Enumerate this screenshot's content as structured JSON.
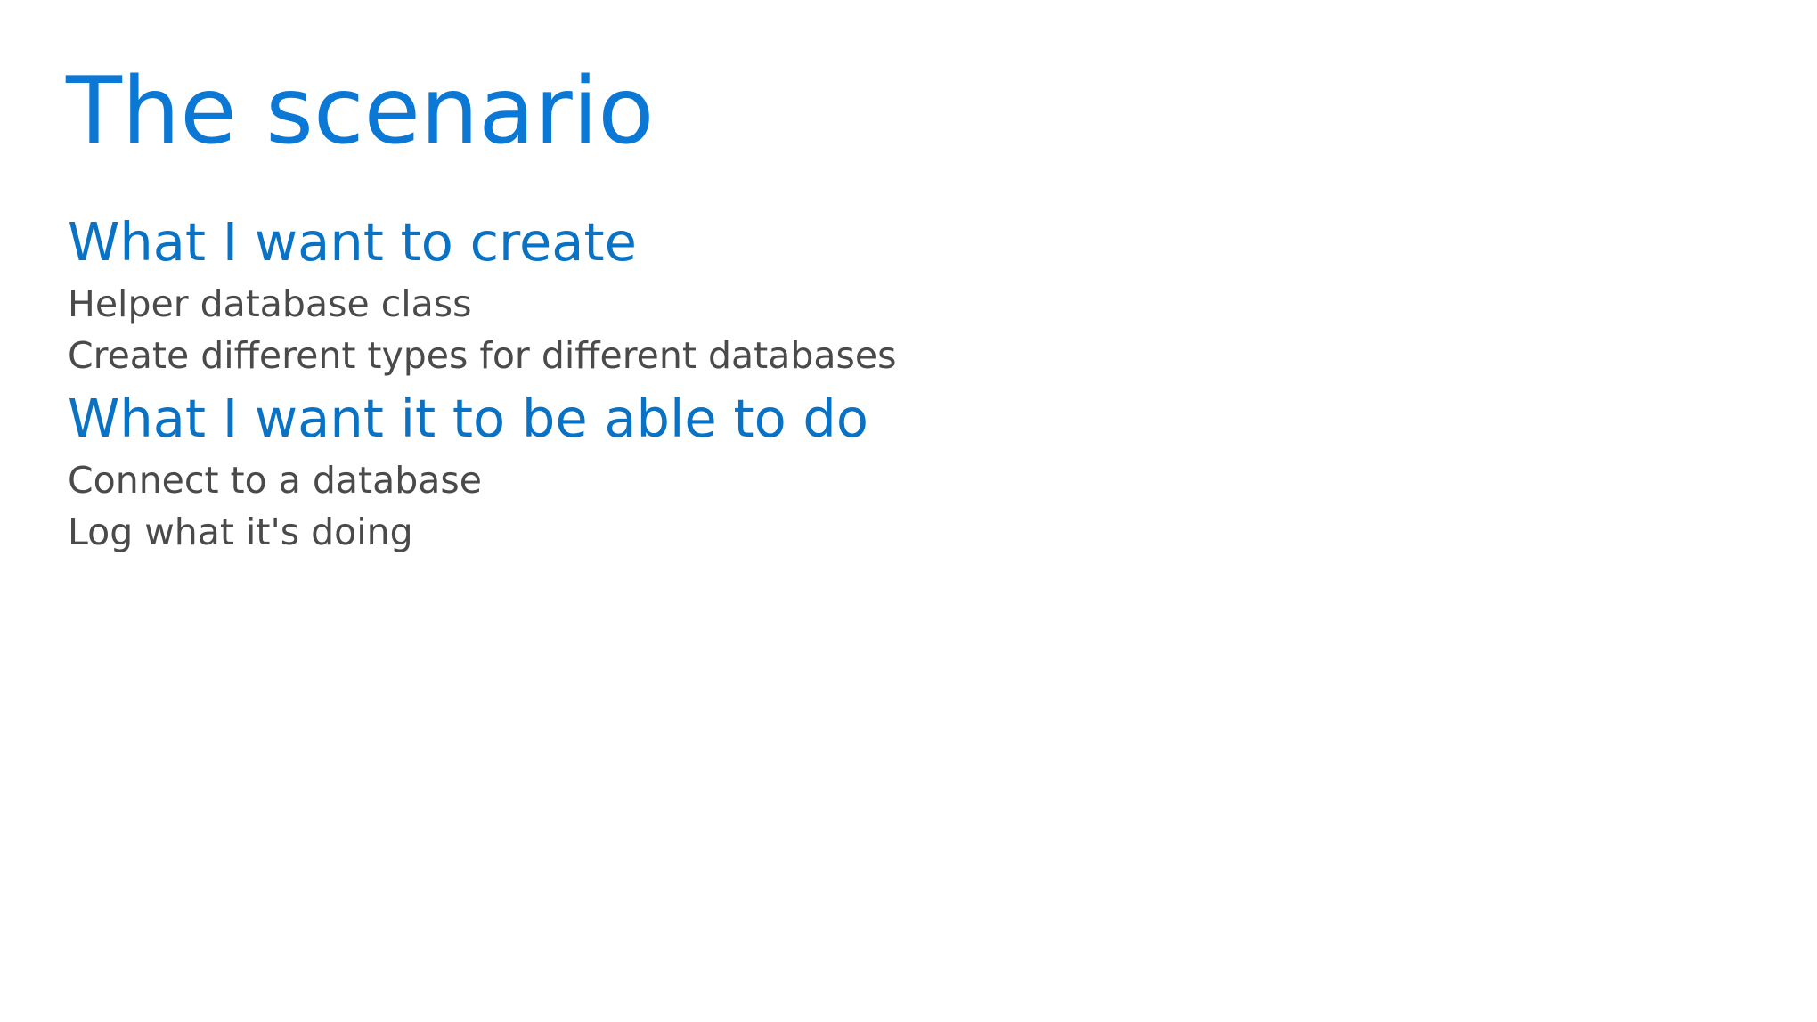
{
  "slide": {
    "title": "The scenario",
    "sections": [
      {
        "heading": "What I want to create",
        "items": [
          "Helper database class",
          "Create different types for different databases"
        ]
      },
      {
        "heading": "What I want it to be able to do",
        "items": [
          "Connect to a database",
          "Log what it's doing"
        ]
      }
    ],
    "colors": {
      "title": "#0a78d4",
      "heading": "#0a72c4",
      "body_text": "#4a4a4a",
      "background": "#ffffff"
    }
  }
}
